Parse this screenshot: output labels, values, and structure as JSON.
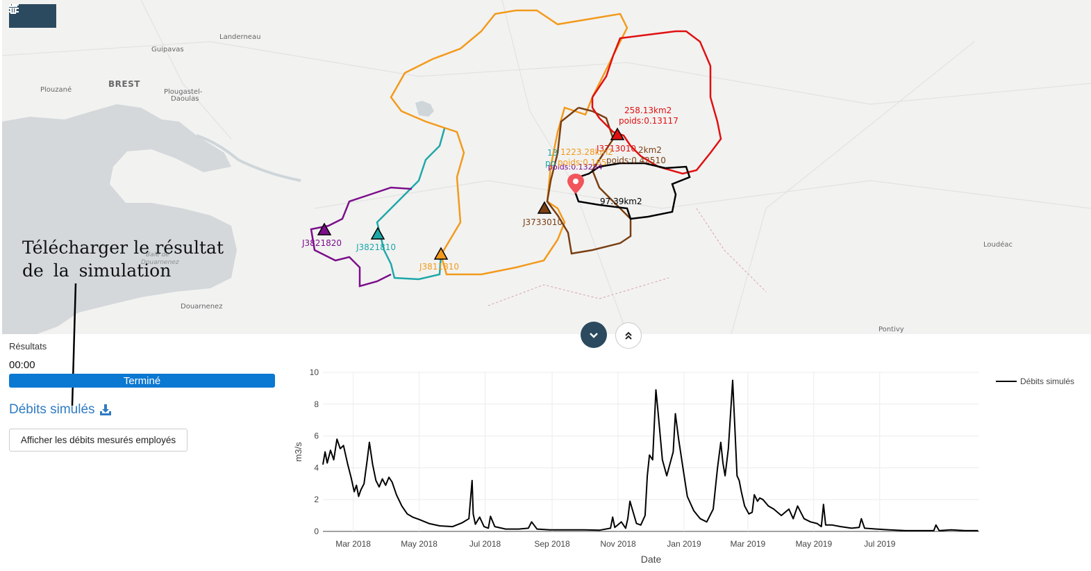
{
  "toolbar": {
    "list_icon": "list-icon",
    "trash_icon": "trash-icon"
  },
  "map": {
    "cities": {
      "landerneau": "Landerneau",
      "guipavas": "Guipavas",
      "brest": "BREST",
      "plouzane": "Plouzané",
      "plougastel1": "Plougastel-",
      "plougastel2": "Daoulas",
      "baie1": "Baie de",
      "baie2": "Douarnenez",
      "douarnenez": "Douarnenez",
      "loudeac": "Loudéac",
      "pontivy": "Pontivy"
    },
    "stations": {
      "s1": {
        "code": "J3821820",
        "color": "#7b0f8a"
      },
      "s2": {
        "code": "J3821810",
        "color": "#1ea7a8"
      },
      "s3": {
        "code": "J3811810",
        "color": "#f39a1b"
      },
      "s4": {
        "code": "J3733010",
        "color": "#7a3f12"
      },
      "s5": {
        "code": "J3713010",
        "color": "#e01010"
      }
    },
    "labels": {
      "red_area": "258.13km2",
      "red_weight": "poids:0.13117",
      "brown_area": "2km2",
      "brown_weight": "poids:0.42510",
      "orange_area": "1223.28km2",
      "orange_weight": "poids:0.165",
      "teal_area": "13",
      "teal_weight": "po",
      "purple_weight": "poids:0.13284",
      "black_area": "97.39km2"
    },
    "marker_icon": "map-pin-icon"
  },
  "annotation": {
    "line1": "Télécharger le résultat",
    "line2": "de la simulation"
  },
  "results": {
    "title": "Résultats",
    "timer": "00:00",
    "status": "Terminé",
    "progress": 1.0,
    "download_label": "Débits simulés",
    "download_icon": "download-icon",
    "show_measured_button": "Afficher les débits mesurés employés"
  },
  "chart_data": {
    "type": "line",
    "xlabel": "Date",
    "ylabel": "m3/s",
    "ylim": [
      0,
      10
    ],
    "yticks": [
      0,
      2,
      4,
      6,
      8,
      10
    ],
    "xlim": [
      "2018-02-01",
      "2019-10-01"
    ],
    "xticks": [
      {
        "date": "2018-03-01",
        "label": "Mar 2018"
      },
      {
        "date": "2018-05-01",
        "label": "May 2018"
      },
      {
        "date": "2018-07-01",
        "label": "Jul 2018"
      },
      {
        "date": "2018-09-01",
        "label": "Sep 2018"
      },
      {
        "date": "2018-11-01",
        "label": "Nov 2018"
      },
      {
        "date": "2019-01-01",
        "label": "Jan 2019"
      },
      {
        "date": "2019-03-01",
        "label": "Mar 2019"
      },
      {
        "date": "2019-05-01",
        "label": "May 2019"
      },
      {
        "date": "2019-07-01",
        "label": "Jul 2019"
      }
    ],
    "grid": true,
    "legend_position": "top-right",
    "series": [
      {
        "name": "Débits simulés",
        "color": "#000000",
        "x": [
          "2018-02-01",
          "2018-02-03",
          "2018-02-05",
          "2018-02-08",
          "2018-02-11",
          "2018-02-14",
          "2018-02-17",
          "2018-02-20",
          "2018-02-24",
          "2018-02-27",
          "2018-03-02",
          "2018-03-04",
          "2018-03-06",
          "2018-03-08",
          "2018-03-11",
          "2018-03-14",
          "2018-03-16",
          "2018-03-19",
          "2018-03-22",
          "2018-03-25",
          "2018-03-28",
          "2018-03-31",
          "2018-04-03",
          "2018-04-06",
          "2018-04-10",
          "2018-04-15",
          "2018-04-20",
          "2018-04-25",
          "2018-05-01",
          "2018-05-10",
          "2018-05-20",
          "2018-06-01",
          "2018-06-10",
          "2018-06-16",
          "2018-06-19",
          "2018-06-20",
          "2018-06-22",
          "2018-06-26",
          "2018-06-30",
          "2018-07-04",
          "2018-07-06",
          "2018-07-10",
          "2018-07-20",
          "2018-08-01",
          "2018-08-10",
          "2018-08-13",
          "2018-08-18",
          "2018-08-30",
          "2018-09-15",
          "2018-10-01",
          "2018-10-15",
          "2018-10-25",
          "2018-10-27",
          "2018-10-29",
          "2018-11-04",
          "2018-11-08",
          "2018-11-10",
          "2018-11-12",
          "2018-11-18",
          "2018-11-22",
          "2018-11-26",
          "2018-11-28",
          "2018-11-30",
          "2018-12-03",
          "2018-12-06",
          "2018-12-08",
          "2018-12-12",
          "2018-12-16",
          "2018-12-20",
          "2018-12-22",
          "2018-12-24",
          "2018-12-27",
          "2018-12-31",
          "2019-01-04",
          "2019-01-10",
          "2019-01-16",
          "2019-01-22",
          "2019-01-28",
          "2019-02-01",
          "2019-02-04",
          "2019-02-06",
          "2019-02-08",
          "2019-02-11",
          "2019-02-15",
          "2019-02-17",
          "2019-02-19",
          "2019-02-21",
          "2019-02-23",
          "2019-02-26",
          "2019-03-02",
          "2019-03-05",
          "2019-03-07",
          "2019-03-10",
          "2019-03-12",
          "2019-03-15",
          "2019-03-20",
          "2019-03-25",
          "2019-04-01",
          "2019-04-08",
          "2019-04-12",
          "2019-04-16",
          "2019-04-22",
          "2019-04-28",
          "2019-05-04",
          "2019-05-08",
          "2019-05-10",
          "2019-05-12",
          "2019-05-18",
          "2019-05-26",
          "2019-06-05",
          "2019-06-12",
          "2019-06-14",
          "2019-06-17",
          "2019-06-28",
          "2019-07-10",
          "2019-07-25",
          "2019-08-10",
          "2019-08-20",
          "2019-08-22",
          "2019-08-25",
          "2019-09-05",
          "2019-09-18",
          "2019-09-30"
        ],
        "y": [
          4.2,
          5.0,
          4.3,
          5.1,
          4.5,
          5.8,
          5.2,
          5.4,
          4.2,
          3.4,
          2.5,
          2.9,
          2.2,
          2.6,
          3.0,
          4.5,
          5.6,
          4.2,
          3.2,
          2.8,
          3.3,
          2.9,
          3.4,
          3.1,
          2.3,
          1.6,
          1.1,
          0.9,
          0.75,
          0.5,
          0.35,
          0.3,
          0.55,
          0.8,
          3.2,
          1.1,
          0.45,
          0.9,
          0.3,
          0.2,
          0.95,
          0.3,
          0.15,
          0.15,
          0.2,
          0.6,
          0.15,
          0.1,
          0.1,
          0.1,
          0.08,
          0.2,
          0.9,
          0.25,
          0.6,
          0.2,
          0.8,
          1.9,
          0.5,
          0.4,
          1.0,
          3.5,
          4.8,
          4.5,
          8.9,
          7.5,
          4.5,
          3.5,
          4.5,
          5.0,
          7.4,
          5.8,
          4.0,
          2.2,
          1.3,
          0.8,
          0.6,
          1.4,
          4.0,
          5.6,
          4.3,
          3.5,
          5.2,
          9.5,
          6.5,
          3.5,
          3.2,
          2.5,
          1.6,
          1.1,
          1.2,
          2.3,
          1.9,
          2.1,
          2.0,
          1.6,
          1.4,
          1.0,
          1.4,
          0.8,
          1.6,
          0.8,
          0.6,
          0.5,
          0.3,
          1.7,
          0.4,
          0.4,
          0.3,
          0.2,
          0.25,
          0.8,
          0.2,
          0.15,
          0.1,
          0.05,
          0.05,
          0.05,
          0.4,
          0.05,
          0.1,
          0.05,
          0.05
        ]
      }
    ]
  }
}
